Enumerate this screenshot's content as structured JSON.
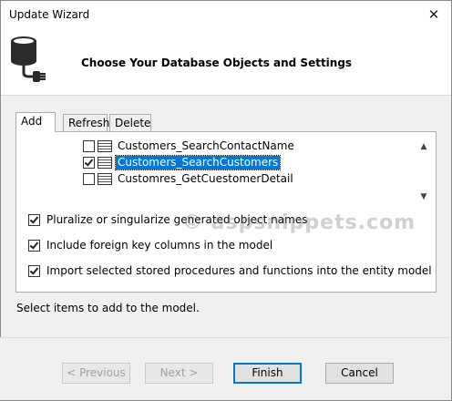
{
  "window": {
    "title": "Update Wizard",
    "close_glyph": "✕"
  },
  "header": {
    "title": "Choose Your Database Objects and Settings",
    "icon": "database-plug-icon"
  },
  "tabs": [
    {
      "label": "Add",
      "active": true
    },
    {
      "label": "Refresh",
      "active": false
    },
    {
      "label": "Delete",
      "active": false
    }
  ],
  "objects": {
    "items": [
      {
        "label": "Customers_SearchContactName",
        "checked": false,
        "selected": false
      },
      {
        "label": "Customers_SearchCustomers",
        "checked": true,
        "selected": true
      },
      {
        "label": "Customres_GetCuestomerDetail",
        "checked": false,
        "selected": false
      }
    ],
    "scroll_up": "▲",
    "scroll_down": "▼"
  },
  "options": [
    {
      "label": "Pluralize or singularize generated object names",
      "checked": true
    },
    {
      "label": "Include foreign key columns in the model",
      "checked": true
    },
    {
      "label": "Import selected stored procedures and functions into the entity model",
      "checked": true
    }
  ],
  "watermark": "© aspsnippets.com",
  "status_text": "Select items to add to the model.",
  "buttons": {
    "previous": "< Previous",
    "next": "Next >",
    "finish": "Finish",
    "cancel": "Cancel"
  },
  "colors": {
    "selection": "#0078d7",
    "default_button_border": "#0078d7"
  }
}
